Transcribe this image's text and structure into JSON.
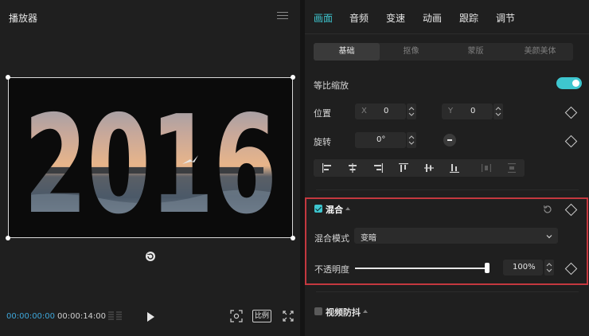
{
  "player": {
    "title": "播放器",
    "time_current": "00:00:00:00",
    "time_total": "00:00:14:00",
    "ratio_label": "比例",
    "overlay_text": "2016"
  },
  "inspector": {
    "tabs": [
      "画面",
      "音频",
      "变速",
      "动画",
      "跟踪",
      "调节"
    ],
    "active_tab": "画面",
    "subtabs": [
      "基础",
      "抠像",
      "蒙版",
      "美颜美体"
    ],
    "active_subtab": "基础",
    "uniform_scale_label": "等比缩放",
    "uniform_scale_on": true,
    "position_label": "位置",
    "position_x_prefix": "X",
    "position_x": "0",
    "position_y_prefix": "Y",
    "position_y": "0",
    "rotation_label": "旋转",
    "rotation_value": "0°",
    "blend": {
      "label": "混合",
      "checked": true,
      "mode_label": "混合模式",
      "mode_value": "变暗",
      "opacity_label": "不透明度",
      "opacity_value": "100%",
      "opacity_level": 1.0
    },
    "stabilize": {
      "label": "视频防抖",
      "checked": false
    }
  },
  "colors": {
    "accent": "#3ec6cf",
    "highlight_border": "#c4383f",
    "timecode_current": "#3ea6d9",
    "panel_bg": "#1f1f1f",
    "app_bg": "#141414"
  }
}
